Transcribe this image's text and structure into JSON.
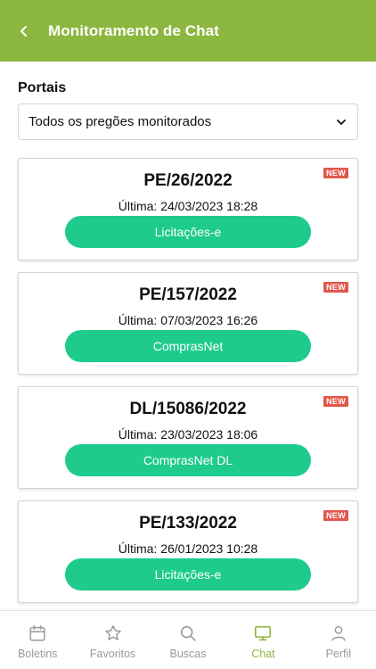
{
  "header": {
    "title": "Monitoramento de Chat"
  },
  "filter": {
    "label": "Portais",
    "selected": "Todos os pregões monitorados"
  },
  "cards": [
    {
      "title": "PE/26/2022",
      "last": "Última: 24/03/2023 18:28",
      "portal": "Licitações-e",
      "badge": "NEW"
    },
    {
      "title": "PE/157/2022",
      "last": "Última: 07/03/2023 16:26",
      "portal": "ComprasNet",
      "badge": "NEW"
    },
    {
      "title": "DL/15086/2022",
      "last": "Última: 23/03/2023 18:06",
      "portal": "ComprasNet DL",
      "badge": "NEW"
    },
    {
      "title": "PE/133/2022",
      "last": "Última: 26/01/2023 10:28",
      "portal": "Licitações-e",
      "badge": "NEW"
    }
  ],
  "tabs": [
    {
      "label": "Boletins",
      "icon": "calendar-icon"
    },
    {
      "label": "Favoritos",
      "icon": "star-icon"
    },
    {
      "label": "Buscas",
      "icon": "search-icon"
    },
    {
      "label": "Chat",
      "icon": "monitor-icon",
      "active": true
    },
    {
      "label": "Perfil",
      "icon": "user-icon"
    }
  ],
  "colors": {
    "header": "#8cb73f",
    "button": "#1ecb8d",
    "badge": "#e2574c",
    "active_tab": "#8cb73f",
    "inactive_tab": "#9a9a9a"
  }
}
